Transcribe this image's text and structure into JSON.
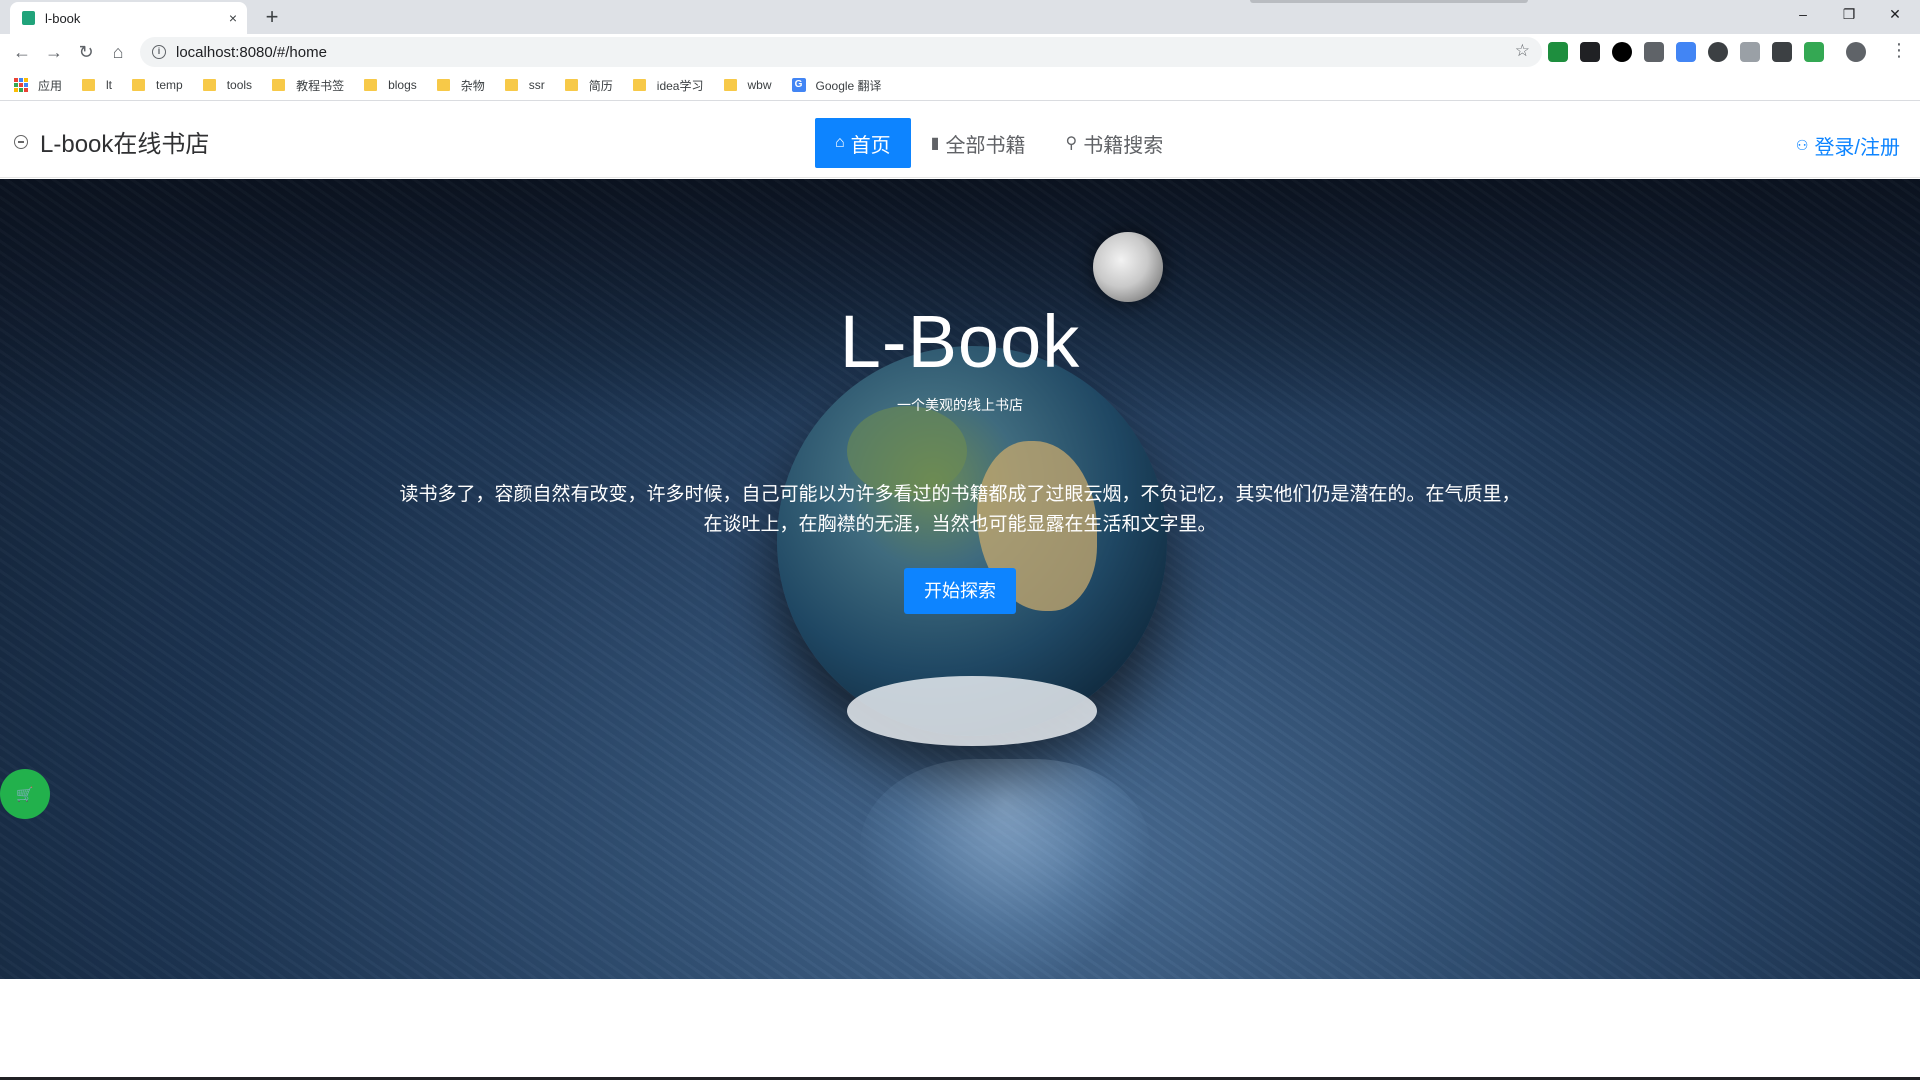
{
  "browser": {
    "tab_title": "l-book",
    "tab_close": "×",
    "new_tab": "+",
    "window_controls": {
      "minimize": "–",
      "restore": "❐",
      "close": "✕"
    },
    "nav": {
      "back": "←",
      "forward": "→",
      "reload": "↻",
      "home": "⌂"
    },
    "url": "localhost:8080/#/home",
    "star": "☆",
    "menu": "⋮",
    "bookmarks": [
      "应用",
      "lt",
      "temp",
      "tools",
      "教程书签",
      "blogs",
      "杂物",
      "ssr",
      "简历",
      "idea学习",
      "wbw",
      "Google 翻译"
    ]
  },
  "header": {
    "brand": "L-book在线书店",
    "nav": [
      {
        "label": "首页",
        "icon": "home-icon",
        "glyph": "⌂",
        "active": true
      },
      {
        "label": "全部书籍",
        "icon": "book-icon",
        "glyph": "▮",
        "active": false
      },
      {
        "label": "书籍搜索",
        "icon": "search-icon",
        "glyph": "⚲",
        "active": false
      }
    ],
    "login": {
      "label": "登录/注册",
      "icon": "user-icon",
      "glyph": "⚇"
    }
  },
  "hero": {
    "title": "L-Book",
    "subtitle": "一个美观的线上书店",
    "description": "读书多了，容颜自然有改变，许多时候，自己可能以为许多看过的书籍都成了过眼云烟，不负记忆，其实他们仍是潜在的。在气质里，在谈吐上，在胸襟的无涯，当然也可能显露在生活和文字里。",
    "cta": "开始探索"
  },
  "cart": {
    "glyph": "🛒",
    "icon": "cart-icon"
  },
  "colors": {
    "primary": "#0d84ff",
    "cart": "#22b14c",
    "hero_bg": "#1c3350"
  }
}
